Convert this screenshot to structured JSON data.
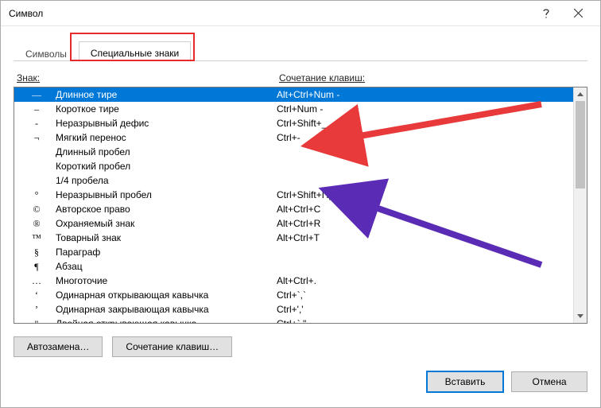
{
  "window": {
    "title": "Символ",
    "help_icon": "help-icon",
    "close_icon": "close-icon"
  },
  "tabs": {
    "tab0": "Символы",
    "tab1": "Специальные знаки",
    "active_index": 1
  },
  "columns": {
    "sign": "Знак:",
    "shortcut": "Сочетание клавиш:"
  },
  "rows": [
    {
      "sym": "—",
      "name": "Длинное тире",
      "short": "Alt+Ctrl+Num -",
      "selected": true
    },
    {
      "sym": "–",
      "name": "Короткое тире",
      "short": "Ctrl+Num -"
    },
    {
      "sym": "-",
      "name": "Неразрывный дефис",
      "short": "Ctrl+Shift+_"
    },
    {
      "sym": "¬",
      "name": "Мягкий перенос",
      "short": "Ctrl+-"
    },
    {
      "sym": "",
      "name": "Длинный пробел",
      "short": ""
    },
    {
      "sym": "",
      "name": "Короткий пробел",
      "short": ""
    },
    {
      "sym": "",
      "name": "1/4 пробела",
      "short": ""
    },
    {
      "sym": "°",
      "name": "Неразрывный пробел",
      "short": "Ctrl+Shift+Пробел"
    },
    {
      "sym": "©",
      "name": "Авторское право",
      "short": "Alt+Ctrl+C"
    },
    {
      "sym": "®",
      "name": "Охраняемый знак",
      "short": "Alt+Ctrl+R"
    },
    {
      "sym": "™",
      "name": "Товарный знак",
      "short": "Alt+Ctrl+T"
    },
    {
      "sym": "§",
      "name": "Параграф",
      "short": ""
    },
    {
      "sym": "¶",
      "name": "Абзац",
      "short": ""
    },
    {
      "sym": "…",
      "name": "Многоточие",
      "short": "Alt+Ctrl+."
    },
    {
      "sym": "ʻ",
      "name": "Одинарная открывающая кавычка",
      "short": "Ctrl+`,`"
    },
    {
      "sym": "ʼ",
      "name": "Одинарная закрывающая кавычка",
      "short": "Ctrl+','"
    },
    {
      "sym": "\"",
      "name": "Двойная открывающая кавычка",
      "short": "Ctrl+`,\""
    }
  ],
  "buttons": {
    "autocorrect": "Автозамена…",
    "shortcut_assign": "Сочетание клавиш…",
    "insert": "Вставить",
    "cancel": "Отмена"
  },
  "annotation": {
    "highlight_tab_index": 1,
    "arrows": [
      {
        "color": "#e83a3a"
      },
      {
        "color": "#5a2bb5"
      }
    ]
  }
}
